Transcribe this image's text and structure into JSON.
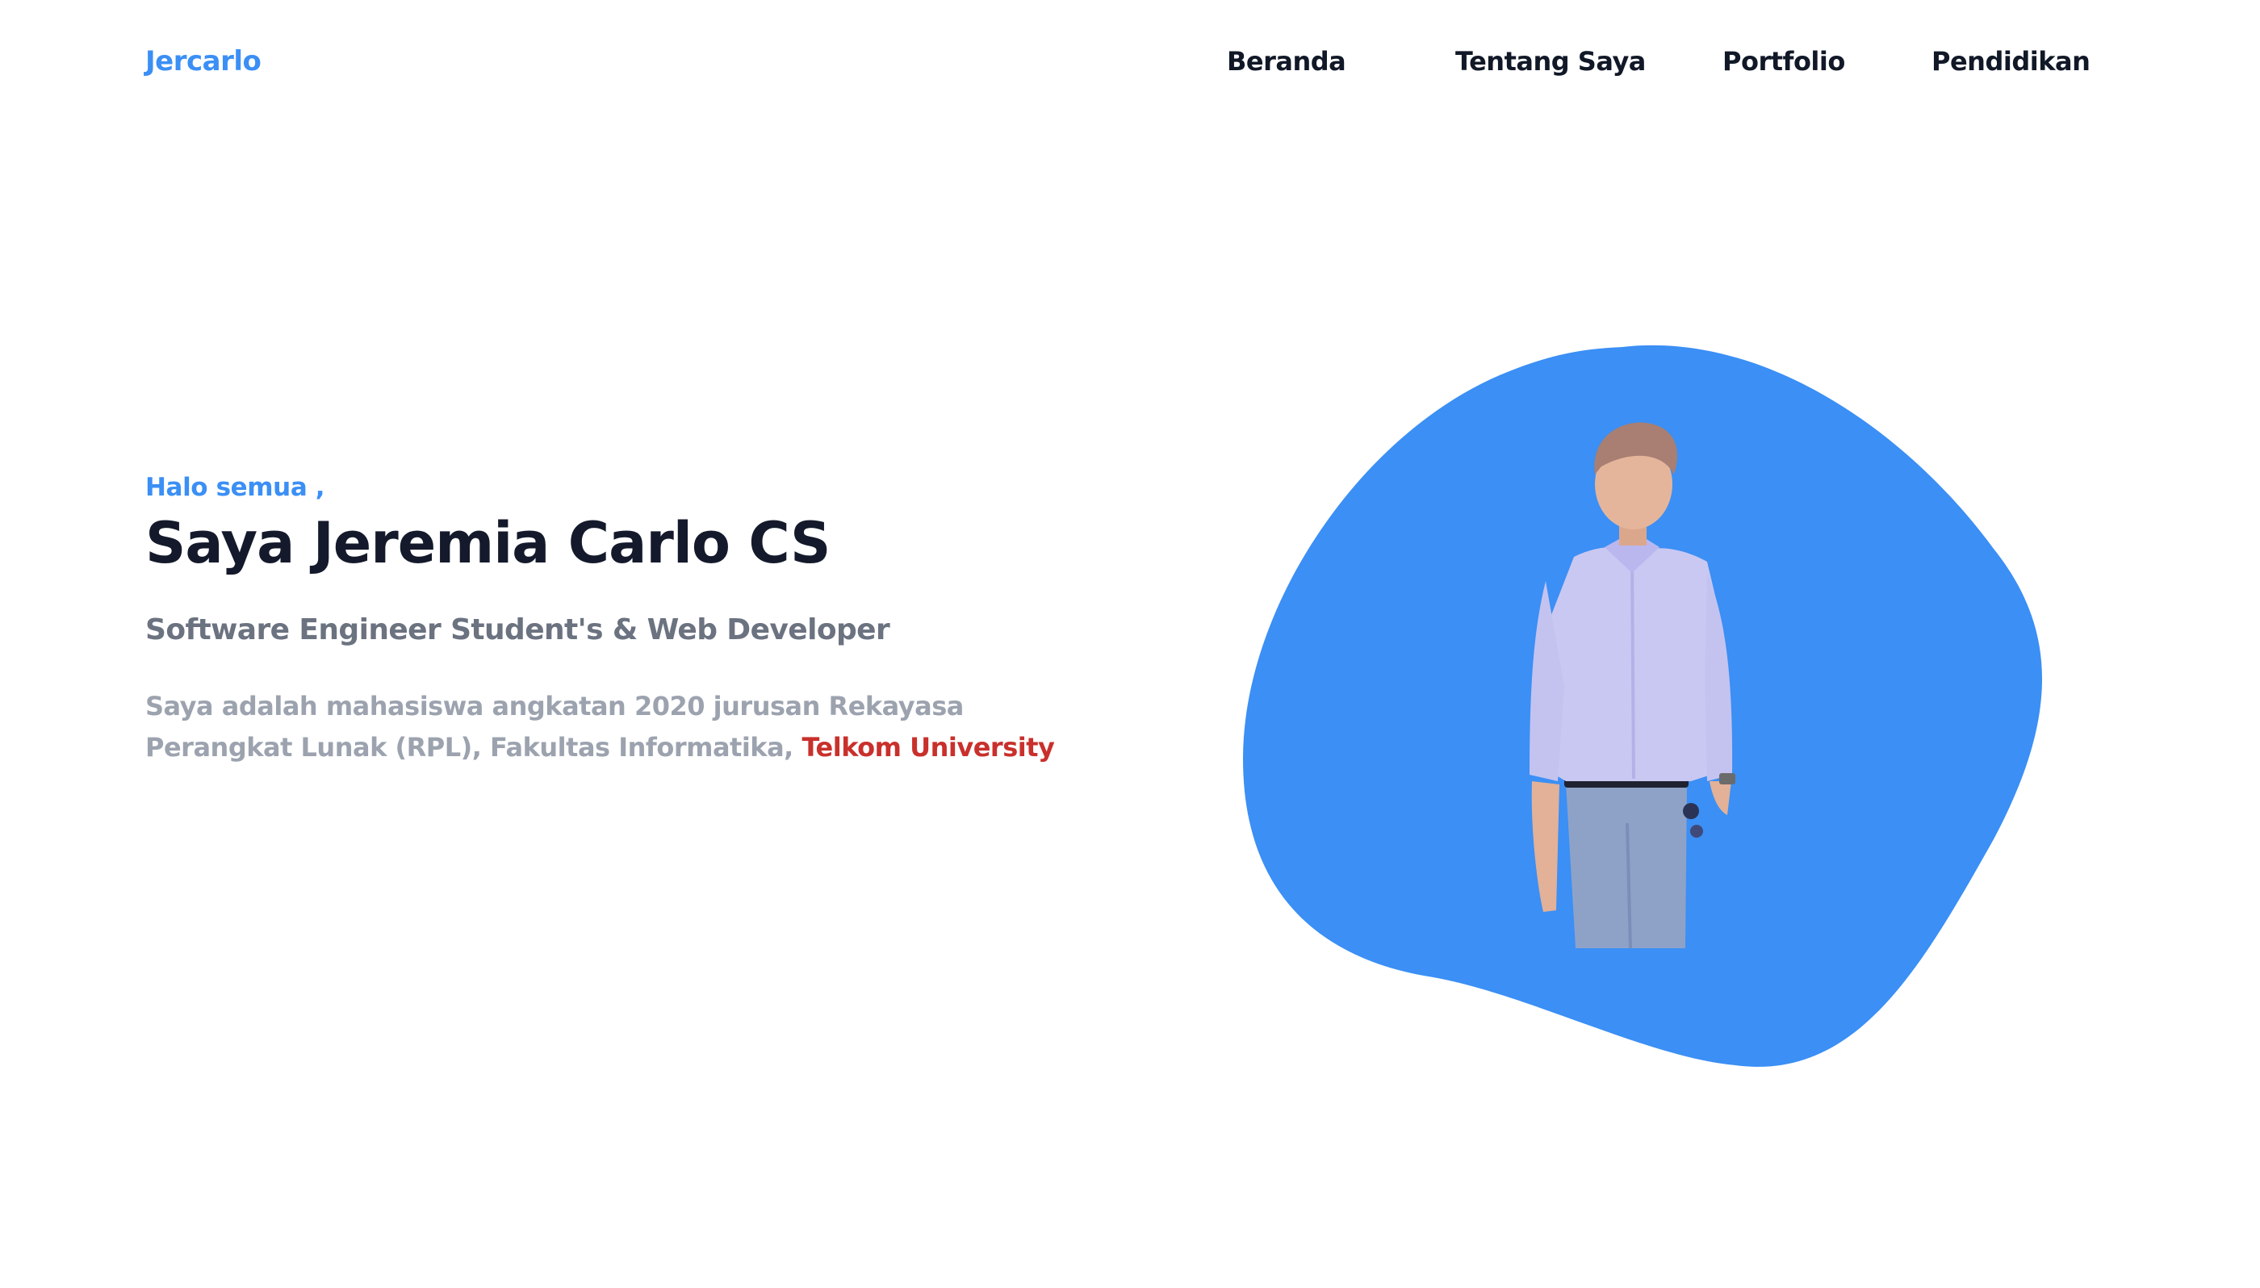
{
  "header": {
    "brand": "Jercarlo",
    "nav": [
      {
        "label": "Beranda"
      },
      {
        "label": "Tentang Saya"
      },
      {
        "label": "Portfolio"
      },
      {
        "label": "Pendidikan"
      }
    ]
  },
  "hero": {
    "greeting": "Halo semua ,",
    "title": "Saya Jeremia Carlo CS",
    "subtitle": "Software Engineer Student's & Web Developer",
    "description_prefix": "Saya adalah mahasiswa angkatan 2020 jurusan Rekayasa Perangkat Lunak (RPL), Fakultas Informatika, ",
    "description_highlight": "Telkom University"
  },
  "colors": {
    "accent": "#3b8ff5",
    "heading": "#141a2b",
    "subtitle": "#6b7280",
    "body": "#9ca3af",
    "highlight": "#c9302c"
  },
  "icons": {
    "photo": "person-portrait-icon"
  }
}
